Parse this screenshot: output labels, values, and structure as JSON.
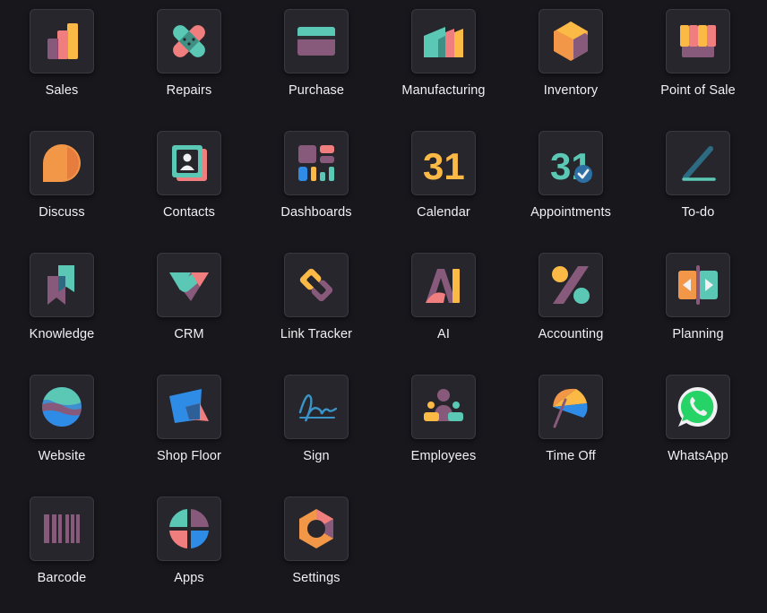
{
  "apps": [
    {
      "id": "sales",
      "label": "Sales",
      "icon": "sales-icon"
    },
    {
      "id": "repairs",
      "label": "Repairs",
      "icon": "repairs-icon"
    },
    {
      "id": "purchase",
      "label": "Purchase",
      "icon": "purchase-icon"
    },
    {
      "id": "manufacturing",
      "label": "Manufacturing",
      "icon": "manufacturing-icon"
    },
    {
      "id": "inventory",
      "label": "Inventory",
      "icon": "inventory-icon"
    },
    {
      "id": "point-of-sale",
      "label": "Point of Sale",
      "icon": "point-of-sale-icon"
    },
    {
      "id": "discuss",
      "label": "Discuss",
      "icon": "discuss-icon"
    },
    {
      "id": "contacts",
      "label": "Contacts",
      "icon": "contacts-icon"
    },
    {
      "id": "dashboards",
      "label": "Dashboards",
      "icon": "dashboards-icon"
    },
    {
      "id": "calendar",
      "label": "Calendar",
      "icon": "calendar-icon",
      "icon_text": "31"
    },
    {
      "id": "appointments",
      "label": "Appointments",
      "icon": "appointments-icon",
      "icon_text": "31"
    },
    {
      "id": "todo",
      "label": "To-do",
      "icon": "todo-icon"
    },
    {
      "id": "knowledge",
      "label": "Knowledge",
      "icon": "knowledge-icon"
    },
    {
      "id": "crm",
      "label": "CRM",
      "icon": "crm-icon"
    },
    {
      "id": "link-tracker",
      "label": "Link Tracker",
      "icon": "link-tracker-icon"
    },
    {
      "id": "ai",
      "label": "AI",
      "icon": "ai-icon",
      "icon_text": "AI"
    },
    {
      "id": "accounting",
      "label": "Accounting",
      "icon": "accounting-icon"
    },
    {
      "id": "planning",
      "label": "Planning",
      "icon": "planning-icon"
    },
    {
      "id": "website",
      "label": "Website",
      "icon": "website-icon"
    },
    {
      "id": "shop-floor",
      "label": "Shop Floor",
      "icon": "shop-floor-icon"
    },
    {
      "id": "sign",
      "label": "Sign",
      "icon": "sign-icon"
    },
    {
      "id": "employees",
      "label": "Employees",
      "icon": "employees-icon"
    },
    {
      "id": "time-off",
      "label": "Time Off",
      "icon": "time-off-icon"
    },
    {
      "id": "whatsapp",
      "label": "WhatsApp",
      "icon": "whatsapp-icon"
    },
    {
      "id": "barcode",
      "label": "Barcode",
      "icon": "barcode-icon"
    },
    {
      "id": "apps",
      "label": "Apps",
      "icon": "apps-icon"
    },
    {
      "id": "settings",
      "label": "Settings",
      "icon": "settings-icon"
    }
  ],
  "colors": {
    "background": "#17171c",
    "tile": "#26262c",
    "label": "#f1f1f3",
    "purple": "#875a7b",
    "orange": "#f29648",
    "teal": "#5ac8b4",
    "pink": "#f17e7e",
    "yellow": "#fbb945",
    "blue": "#2f8ce6",
    "green": "#25d366"
  }
}
